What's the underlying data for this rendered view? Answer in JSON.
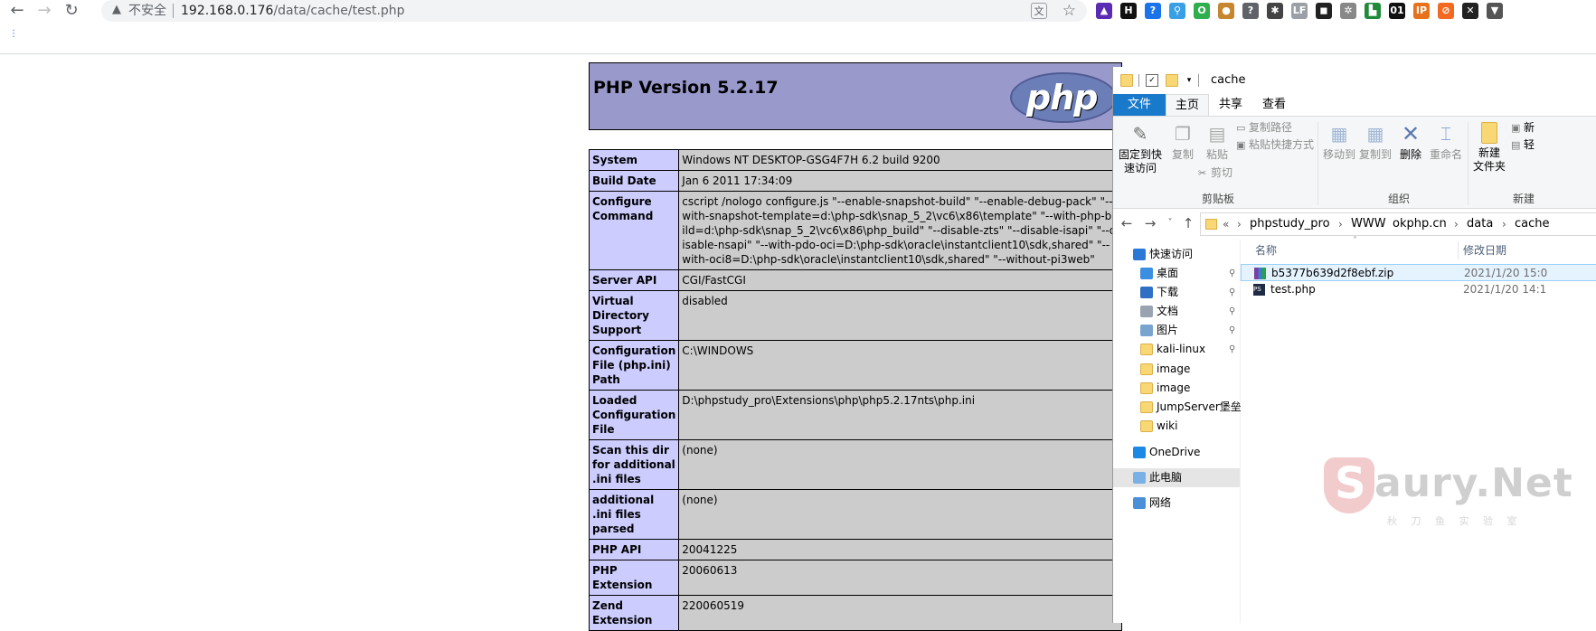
{
  "browser": {
    "security_label": "不安全",
    "url_host": "192.168.0.176",
    "url_path": "/data/cache/test.php",
    "extensions": [
      {
        "name": "ext-hat-icon",
        "glyph": "▲",
        "color": "#5b2cb3"
      },
      {
        "name": "ext-h-icon",
        "glyph": "H",
        "color": "#111111"
      },
      {
        "name": "ext-question-icon",
        "glyph": "?",
        "color": "#1a73e8"
      },
      {
        "name": "ext-pin-icon",
        "glyph": "⚲",
        "color": "#3aa0e6"
      },
      {
        "name": "ext-ring-icon",
        "glyph": "O",
        "color": "#2fae4e"
      },
      {
        "name": "ext-cookie-icon",
        "glyph": "●",
        "color": "#c5862f"
      },
      {
        "name": "ext-help-icon",
        "glyph": "?",
        "color": "#5f6368"
      },
      {
        "name": "ext-gear-icon",
        "glyph": "✱",
        "color": "#444444"
      },
      {
        "name": "ext-lf-icon",
        "glyph": "LF",
        "color": "#9aa0a6"
      },
      {
        "name": "ext-mask-icon",
        "glyph": "◼",
        "color": "#222222"
      },
      {
        "name": "ext-wheel-icon",
        "glyph": "✲",
        "color": "#888888"
      },
      {
        "name": "ext-green-icon",
        "glyph": "▙",
        "color": "#1e8a3a"
      },
      {
        "name": "ext-01-icon",
        "glyph": "01",
        "color": "#111111"
      },
      {
        "name": "ext-ip-icon",
        "glyph": "IP",
        "color": "#e8711c"
      },
      {
        "name": "ext-orange-icon",
        "glyph": "⊘",
        "color": "#f26a21"
      },
      {
        "name": "ext-x-icon",
        "glyph": "✕",
        "color": "#222222"
      },
      {
        "name": "ext-fox-icon",
        "glyph": "▼",
        "color": "#555555"
      }
    ]
  },
  "phpinfo": {
    "title": "PHP Version 5.2.17",
    "logo_text": "php",
    "rows": [
      {
        "label": "System",
        "value": "Windows NT DESKTOP-GSG4F7H 6.2 build 9200"
      },
      {
        "label": "Build Date",
        "value": "Jan 6 2011 17:34:09"
      },
      {
        "label": "Configure Command",
        "value": "cscript /nologo configure.js \"--enable-snapshot-build\" \"--enable-debug-pack\" \"--with-snapshot-template=d:\\php-sdk\\snap_5_2\\vc6\\x86\\template\" \"--with-php-build=d:\\php-sdk\\snap_5_2\\vc6\\x86\\php_build\" \"--disable-zts\" \"--disable-isapi\" \"--disable-nsapi\" \"--with-pdo-oci=D:\\php-sdk\\oracle\\instantclient10\\sdk,shared\" \"--with-oci8=D:\\php-sdk\\oracle\\instantclient10\\sdk,shared\" \"--without-pi3web\""
      },
      {
        "label": "Server API",
        "value": "CGI/FastCGI"
      },
      {
        "label": "Virtual Directory Support",
        "value": "disabled"
      },
      {
        "label": "Configuration File (php.ini) Path",
        "value": "C:\\WINDOWS"
      },
      {
        "label": "Loaded Configuration File",
        "value": "D:\\phpstudy_pro\\Extensions\\php\\php5.2.17nts\\php.ini"
      },
      {
        "label": "Scan this dir for additional .ini files",
        "value": "(none)"
      },
      {
        "label": "additional .ini files parsed",
        "value": "(none)"
      },
      {
        "label": "PHP API",
        "value": "20041225"
      },
      {
        "label": "PHP Extension",
        "value": "20060613"
      },
      {
        "label": "Zend Extension",
        "value": "220060519"
      }
    ]
  },
  "explorer": {
    "title": "cache",
    "tabs": {
      "file": "文件",
      "home": "主页",
      "share": "共享",
      "view": "查看"
    },
    "ribbon": {
      "pin_quick_access": "固定到快\n速访问",
      "copy": "复制",
      "paste": "粘贴",
      "copy_path": "复制路径",
      "paste_shortcut": "粘贴快捷方式",
      "cut": "剪切",
      "clipboard_group": "剪贴板",
      "move_to": "移动到",
      "copy_to": "复制到",
      "delete": "删除",
      "rename": "重命名",
      "organize_group": "组织",
      "new_folder": "新建\n文件夹",
      "new_group": "新建",
      "new_item": "新",
      "easy_access": "轻"
    },
    "breadcrumbs": [
      "phpstudy_pro",
      "WWW",
      "okphp.cn",
      "data",
      "cache"
    ],
    "breadcrumb_prefix": "«",
    "nav": [
      {
        "label": "快速访问",
        "icon": "star",
        "pinned": false
      },
      {
        "label": "桌面",
        "icon": "desktop",
        "pinned": true
      },
      {
        "label": "下载",
        "icon": "download",
        "pinned": true
      },
      {
        "label": "文档",
        "icon": "document",
        "pinned": true
      },
      {
        "label": "图片",
        "icon": "picture",
        "pinned": true
      },
      {
        "label": "kali-linux",
        "icon": "folder",
        "pinned": true
      },
      {
        "label": "image",
        "icon": "folder",
        "pinned": false
      },
      {
        "label": "image",
        "icon": "folder",
        "pinned": false
      },
      {
        "label": "JumpServer堡垒机",
        "icon": "folder",
        "pinned": false
      },
      {
        "label": "wiki",
        "icon": "folder",
        "pinned": false
      },
      {
        "label": "OneDrive",
        "icon": "cloud",
        "pinned": false
      },
      {
        "label": "此电脑",
        "icon": "computer",
        "pinned": false
      },
      {
        "label": "网络",
        "icon": "network",
        "pinned": false
      }
    ],
    "columns": {
      "name": "名称",
      "modified": "修改日期"
    },
    "files": [
      {
        "name": "b5377b639d2f8ebf.zip",
        "modified": "2021/1/20 15:0",
        "icon": "zip"
      },
      {
        "name": "test.php",
        "modified": "2021/1/20 14:1",
        "icon": "php"
      }
    ]
  },
  "watermark": {
    "logo_letter": "S",
    "text": "aury.Net",
    "subtitle": "秋 刀 鱼 实 验 室"
  }
}
